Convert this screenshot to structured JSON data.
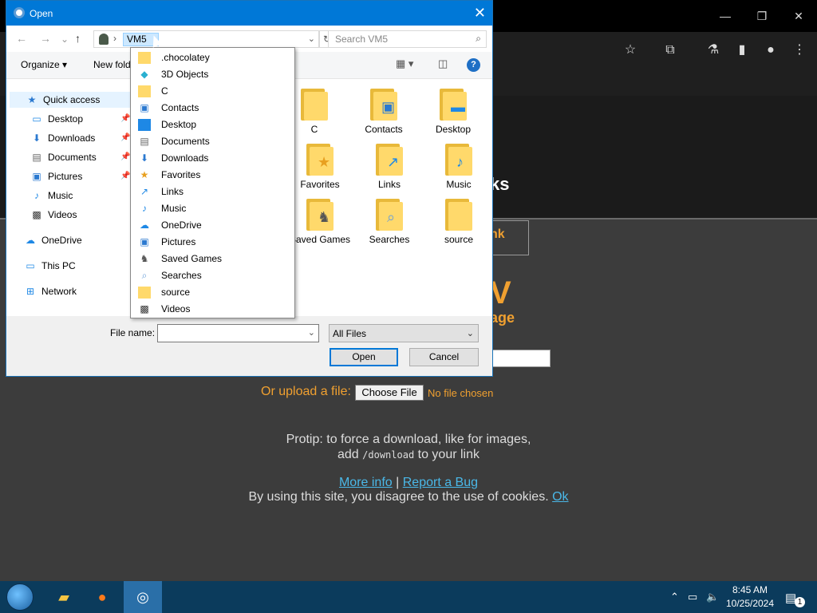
{
  "dialog": {
    "title": "Open",
    "address_crumb": "VM5",
    "search_placeholder": "Search VM5",
    "organize_label": "Organize",
    "new_folder_label": "New fold",
    "file_name_label": "File name:",
    "file_name_value": "",
    "filter_value": "All Files",
    "open_button": "Open",
    "cancel_button": "Cancel"
  },
  "nav_pane": {
    "items": [
      {
        "label": "Quick access",
        "icon": "star-icon"
      },
      {
        "label": "Desktop",
        "icon": "desktop-icon"
      },
      {
        "label": "Downloads",
        "icon": "downloads-icon"
      },
      {
        "label": "Documents",
        "icon": "documents-icon"
      },
      {
        "label": "Pictures",
        "icon": "pictures-icon"
      },
      {
        "label": "Music",
        "icon": "music-icon"
      },
      {
        "label": "Videos",
        "icon": "videos-icon"
      },
      {
        "label": "OneDrive",
        "icon": "cloud-icon"
      },
      {
        "label": "This PC",
        "icon": "computer-icon"
      },
      {
        "label": "Network",
        "icon": "network-icon"
      }
    ]
  },
  "files": [
    {
      "label": "C"
    },
    {
      "label": "Contacts"
    },
    {
      "label": "Desktop"
    },
    {
      "label": "Favorites"
    },
    {
      "label": "Links"
    },
    {
      "label": "Music"
    },
    {
      "label": "Saved Games"
    },
    {
      "label": "Searches"
    },
    {
      "label": "source"
    }
  ],
  "dropdown": {
    "items": [
      {
        "label": ".chocolatey",
        "icon": "folder-icon"
      },
      {
        "label": "3D Objects",
        "icon": "cube-icon"
      },
      {
        "label": "C",
        "icon": "folder-icon"
      },
      {
        "label": "Contacts",
        "icon": "contacts-icon"
      },
      {
        "label": "Desktop",
        "icon": "desktop-icon"
      },
      {
        "label": "Documents",
        "icon": "documents-icon"
      },
      {
        "label": "Downloads",
        "icon": "downloads-icon"
      },
      {
        "label": "Favorites",
        "icon": "star-icon"
      },
      {
        "label": "Links",
        "icon": "link-icon"
      },
      {
        "label": "Music",
        "icon": "music-icon"
      },
      {
        "label": "OneDrive",
        "icon": "cloud-icon"
      },
      {
        "label": "Pictures",
        "icon": "pictures-icon"
      },
      {
        "label": "Saved Games",
        "icon": "games-icon"
      },
      {
        "label": "Searches",
        "icon": "search-icon"
      },
      {
        "label": "source",
        "icon": "folder-icon"
      },
      {
        "label": "Videos",
        "icon": "videos-icon"
      }
    ]
  },
  "page": {
    "title_fragment": "ks",
    "link_fragment": "nk",
    "big_letter": "V",
    "sub_fragment": "age",
    "upload_label": "Or upload a file:",
    "choose_file": "Choose File",
    "no_file": "No file chosen",
    "protip_line1": "Protip: to force a download, like for images,",
    "protip_add": "add",
    "protip_code": "/download",
    "protip_tail": "to your link",
    "more_info": "More info",
    "separator": "|",
    "report_bug": "Report a Bug",
    "cookie_text": "By using this site, you disagree to the use of cookies.",
    "cookie_ok": "Ok"
  },
  "taskbar": {
    "time": "8:45 AM",
    "date": "10/25/2024",
    "notification_count": "1"
  },
  "colors": {
    "accent": "#0078d7",
    "page_orange": "#f0a030",
    "page_link": "#4ab8e8"
  }
}
